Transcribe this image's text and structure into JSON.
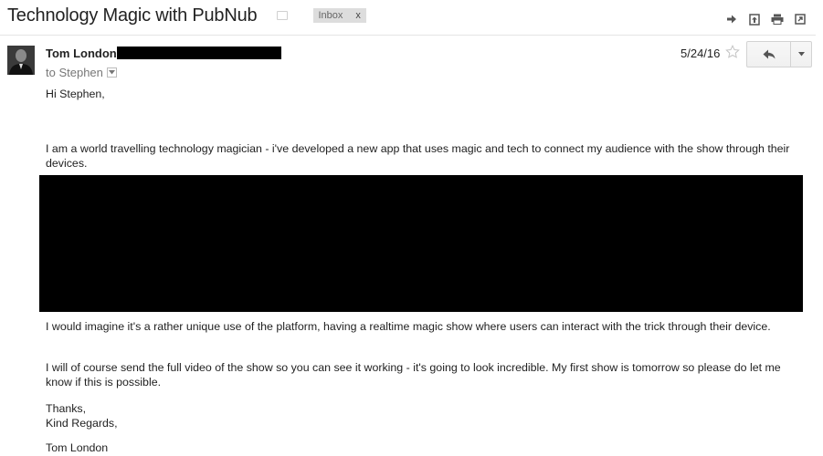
{
  "message": {
    "subject": "Technology Magic with PubNub",
    "label": "Inbox",
    "label_remove": "x",
    "sender_name": "Tom London",
    "to_line": "to Stephen",
    "date": "5/24/16",
    "greeting": "Hi Stephen,",
    "paragraph_1": "I am a world travelling technology magician - i've developed a new app that uses magic and tech to connect my audience with the show through their devices.",
    "paragraph_2": "I would imagine it's a rather unique use of the platform, having a realtime magic show where users can interact with the trick through their device.",
    "paragraph_3": "I will of course send the full video of the show so you can see it working - it's going to look incredible. My first show is tomorrow so please do let me know if this is possible.",
    "closing_1": "Thanks,",
    "closing_2": "Kind Regards,",
    "signature": "Tom London"
  },
  "icons": {
    "top_actions": [
      "forward-icon",
      "archive-icon",
      "print-icon",
      "new-window-icon"
    ],
    "star": "star-icon",
    "reply": "reply-icon",
    "more": "chevron-down-icon"
  },
  "colors": {
    "label_bg": "#dddddd",
    "redaction": "#000000",
    "button_border": "#d3d3d3"
  }
}
